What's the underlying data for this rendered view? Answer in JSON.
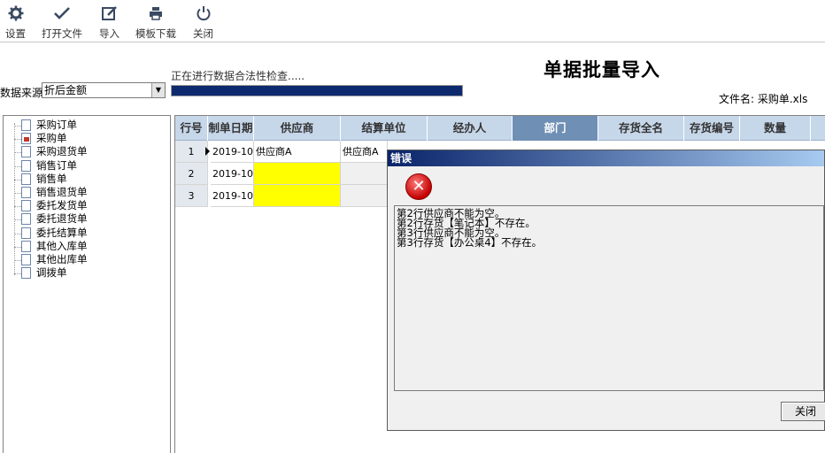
{
  "toolbar": {
    "buttons": [
      {
        "label": "设置",
        "icon": "gear-icon"
      },
      {
        "label": "打开文件",
        "icon": "check-icon"
      },
      {
        "label": "导入",
        "icon": "edit-icon"
      },
      {
        "label": "模板下载",
        "icon": "printer-icon"
      },
      {
        "label": "关闭",
        "icon": "power-icon"
      }
    ]
  },
  "header": {
    "title": "单据批量导入",
    "status": "正在进行数据合法性检查.....",
    "progress": 1.0,
    "file_label": "文件名: 采购单.xls"
  },
  "source": {
    "label": "数据来源",
    "selected": "折后金额"
  },
  "tree": {
    "items": [
      "采购订单",
      "采购单",
      "采购退货单",
      "销售订单",
      "销售单",
      "销售退货单",
      "委托发货单",
      "委托退货单",
      "委托结算单",
      "其他入库单",
      "其他出库单",
      "调拨单"
    ],
    "selected_index": 1
  },
  "grid": {
    "columns": [
      "行号",
      "制单日期",
      "供应商",
      "结算单位",
      "经办人",
      "部门",
      "存货全名",
      "存货编号",
      "数量"
    ],
    "rows": [
      {
        "rn": "1",
        "date": "2019-10-",
        "supplier": "供应商A",
        "settle": "供应商A"
      },
      {
        "rn": "2",
        "date": "2019-10-",
        "supplier": "",
        "settle": ""
      },
      {
        "rn": "3",
        "date": "2019-10-",
        "supplier": "",
        "settle": ""
      }
    ]
  },
  "dialog": {
    "title": "错误",
    "messages": [
      "第2行供应商不能为空。",
      "第2行存货【笔记本】不存在。",
      "第3行供应商不能为空。",
      "第3行存货【办公桌4】不存在。"
    ],
    "close_label": "关闭"
  },
  "colors": {
    "progress_fill": "#0e2a6e",
    "grid_header": "#c7d7ea",
    "selected_column": "#6f8fb5",
    "error_cell": "#ffff00",
    "dialog_title": "#0a246a"
  }
}
